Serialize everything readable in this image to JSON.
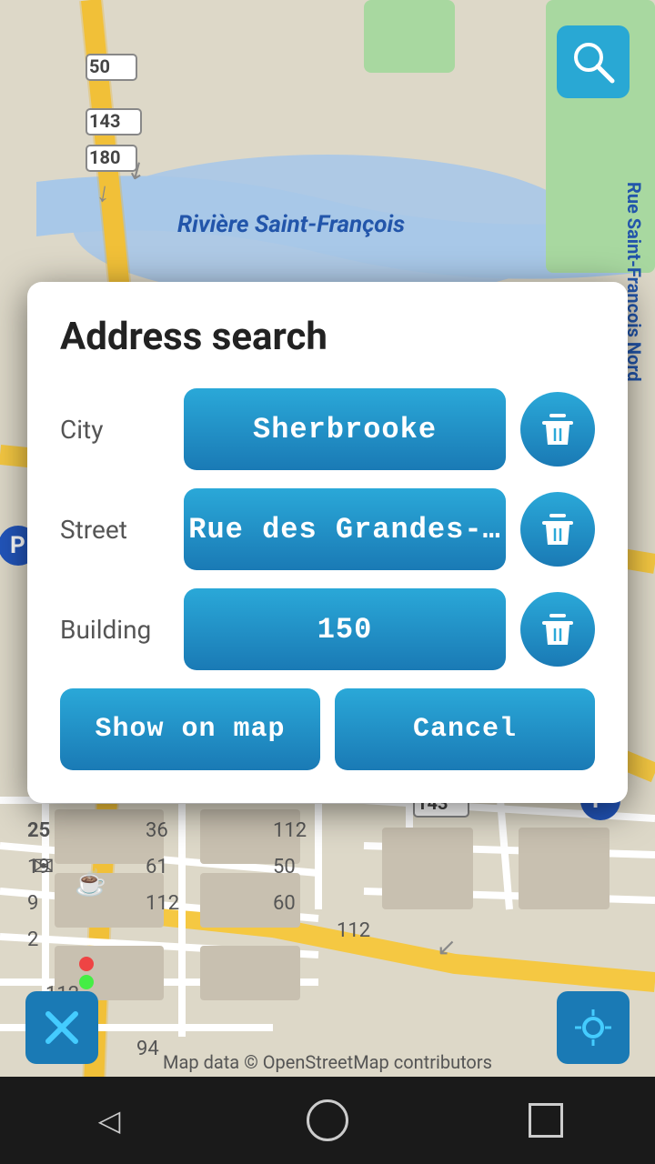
{
  "dialog": {
    "title": "Address search",
    "city_label": "City",
    "city_value": "Sherbrooke",
    "street_label": "Street",
    "street_value": "Rue des Grandes-…",
    "building_label": "Building",
    "building_value": "150",
    "show_on_map_label": "Show on map",
    "cancel_label": "Cancel"
  },
  "map": {
    "river_label": "Rivière Saint-François",
    "attribution": "Map data © OpenStreetMap contributors"
  },
  "nav": {
    "back_label": "◁",
    "home_label": "○",
    "recent_label": "□"
  }
}
